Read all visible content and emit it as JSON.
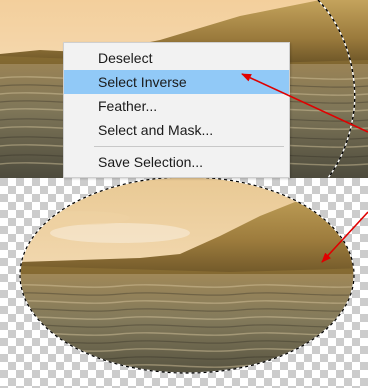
{
  "context_menu": {
    "items": [
      {
        "label": "Deselect",
        "highlighted": false
      },
      {
        "label": "Select Inverse",
        "highlighted": true
      },
      {
        "label": "Feather...",
        "highlighted": false
      },
      {
        "label": "Select and Mask...",
        "highlighted": false
      },
      {
        "label": "Save Selection...",
        "highlighted": false
      }
    ],
    "highlight_color": "#91c9f7"
  },
  "annotation_color": "#e00000",
  "transparency_checker_colors": [
    "#ffffff",
    "#cccccc"
  ]
}
